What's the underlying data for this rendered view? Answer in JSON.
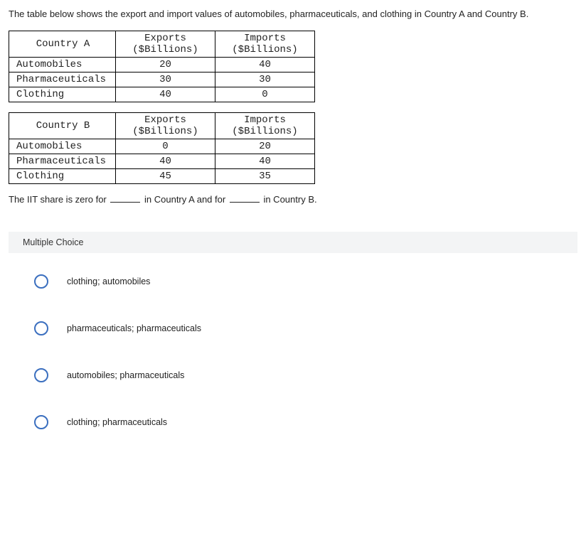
{
  "intro": "The table below shows the export and import values of automobiles, pharmaceuticals, and clothing in Country A and Country B.",
  "headers": {
    "exports_line1": "Exports",
    "exports_line2": "($Billions)",
    "imports_line1": "Imports",
    "imports_line2": "($Billions)"
  },
  "tableA": {
    "title": "Country A",
    "rows": [
      {
        "label": "Automobiles",
        "exports": "20",
        "imports": "40"
      },
      {
        "label": "Pharmaceuticals",
        "exports": "30",
        "imports": "30"
      },
      {
        "label": "Clothing",
        "exports": "40",
        "imports": "0"
      }
    ]
  },
  "tableB": {
    "title": "Country B",
    "rows": [
      {
        "label": "Automobiles",
        "exports": "0",
        "imports": "20"
      },
      {
        "label": "Pharmaceuticals",
        "exports": "40",
        "imports": "40"
      },
      {
        "label": "Clothing",
        "exports": "45",
        "imports": "35"
      }
    ]
  },
  "question": {
    "part1": "The IIT share is zero for",
    "part2": "in Country A and for",
    "part3": "in Country B."
  },
  "mc": {
    "heading": "Multiple Choice",
    "options": [
      "clothing; automobiles",
      "pharmaceuticals; pharmaceuticals",
      "automobiles; pharmaceuticals",
      "clothing; pharmaceuticals"
    ]
  }
}
